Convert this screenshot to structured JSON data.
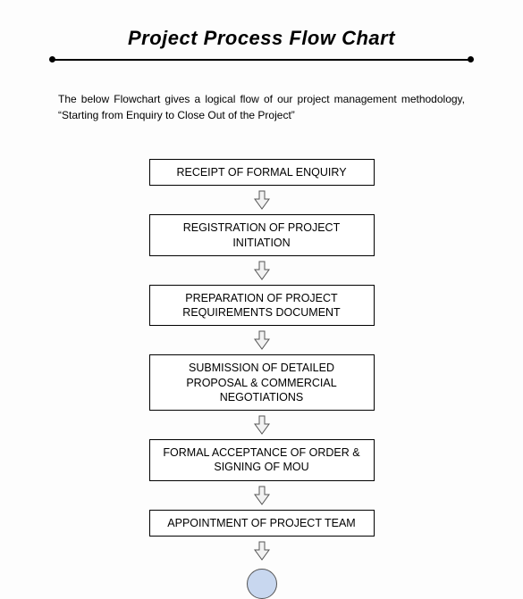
{
  "title": "Project Process Flow Chart",
  "intro": "The below Flowchart gives a logical flow of our project management methodology, “Starting from Enquiry to Close Out of the Project”",
  "steps": [
    "RECEIPT OF FORMAL ENQUIRY",
    "REGISTRATION OF PROJECT INITIATION",
    "PREPARATION OF PROJECT REQUIREMENTS DOCUMENT",
    "SUBMISSION OF DETAILED PROPOSAL & COMMERCIAL NEGOTIATIONS",
    "FORMAL ACCEPTANCE OF ORDER & SIGNING OF MOU",
    "APPOINTMENT OF PROJECT TEAM"
  ]
}
